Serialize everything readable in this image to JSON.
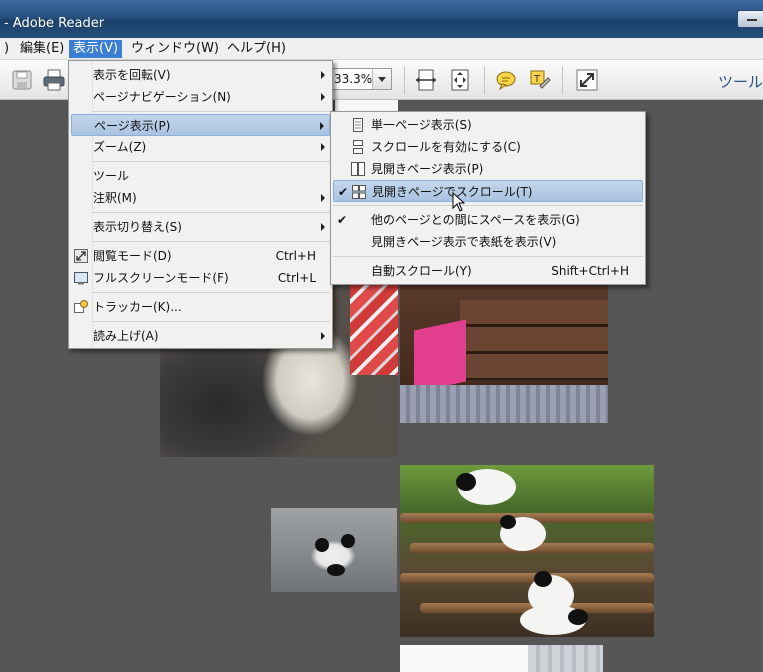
{
  "window": {
    "title": "- Adobe Reader"
  },
  "menubar": {
    "items": [
      {
        "label": ")"
      },
      {
        "label": "編集(E)"
      },
      {
        "label": "表示(V)",
        "active": true
      },
      {
        "label": "ウィンドウ(W)"
      },
      {
        "label": "ヘルプ(H)"
      }
    ]
  },
  "toolbar": {
    "zoom": "33.3%",
    "tools_label": "ツール"
  },
  "view_menu": {
    "items": [
      {
        "label": "表示を回転(V)",
        "submenu": true
      },
      {
        "label": "ページナビゲーション(N)",
        "submenu": true
      },
      {
        "label": "ページ表示(P)",
        "submenu": true,
        "highlighted": true
      },
      {
        "label": "ズーム(Z)",
        "submenu": true
      },
      {
        "label": "ツール"
      },
      {
        "label": "注釈(M)",
        "submenu": true
      },
      {
        "label": "表示切り替え(S)",
        "submenu": true
      },
      {
        "label": "閲覧モード(D)",
        "shortcut": "Ctrl+H",
        "icon": "read-mode-icon"
      },
      {
        "label": "フルスクリーンモード(F)",
        "shortcut": "Ctrl+L",
        "icon": "fullscreen-icon"
      },
      {
        "label": "トラッカー(K)...",
        "icon": "tracker-icon"
      },
      {
        "label": "読み上げ(A)",
        "submenu": true
      }
    ]
  },
  "page_display_submenu": {
    "items": [
      {
        "label": "単一ページ表示(S)",
        "icon": "single-page-icon"
      },
      {
        "label": "スクロールを有効にする(C)",
        "icon": "scroll-icon"
      },
      {
        "label": "見開きページ表示(P)",
        "icon": "two-page-icon"
      },
      {
        "label": "見開きページでスクロール(T)",
        "icon": "two-page-scroll-icon",
        "checked": true,
        "highlighted": true
      },
      {
        "label": "他のページとの間にスペースを表示(G)",
        "checked": true
      },
      {
        "label": "見開きページ表示で表紙を表示(V)"
      },
      {
        "label": "自動スクロール(Y)",
        "shortcut": "Shift+Ctrl+H"
      }
    ]
  },
  "colors": {
    "highlight": "#a9c3e0",
    "menubar_active": "#3b7ed6",
    "canvas": "#565656"
  }
}
